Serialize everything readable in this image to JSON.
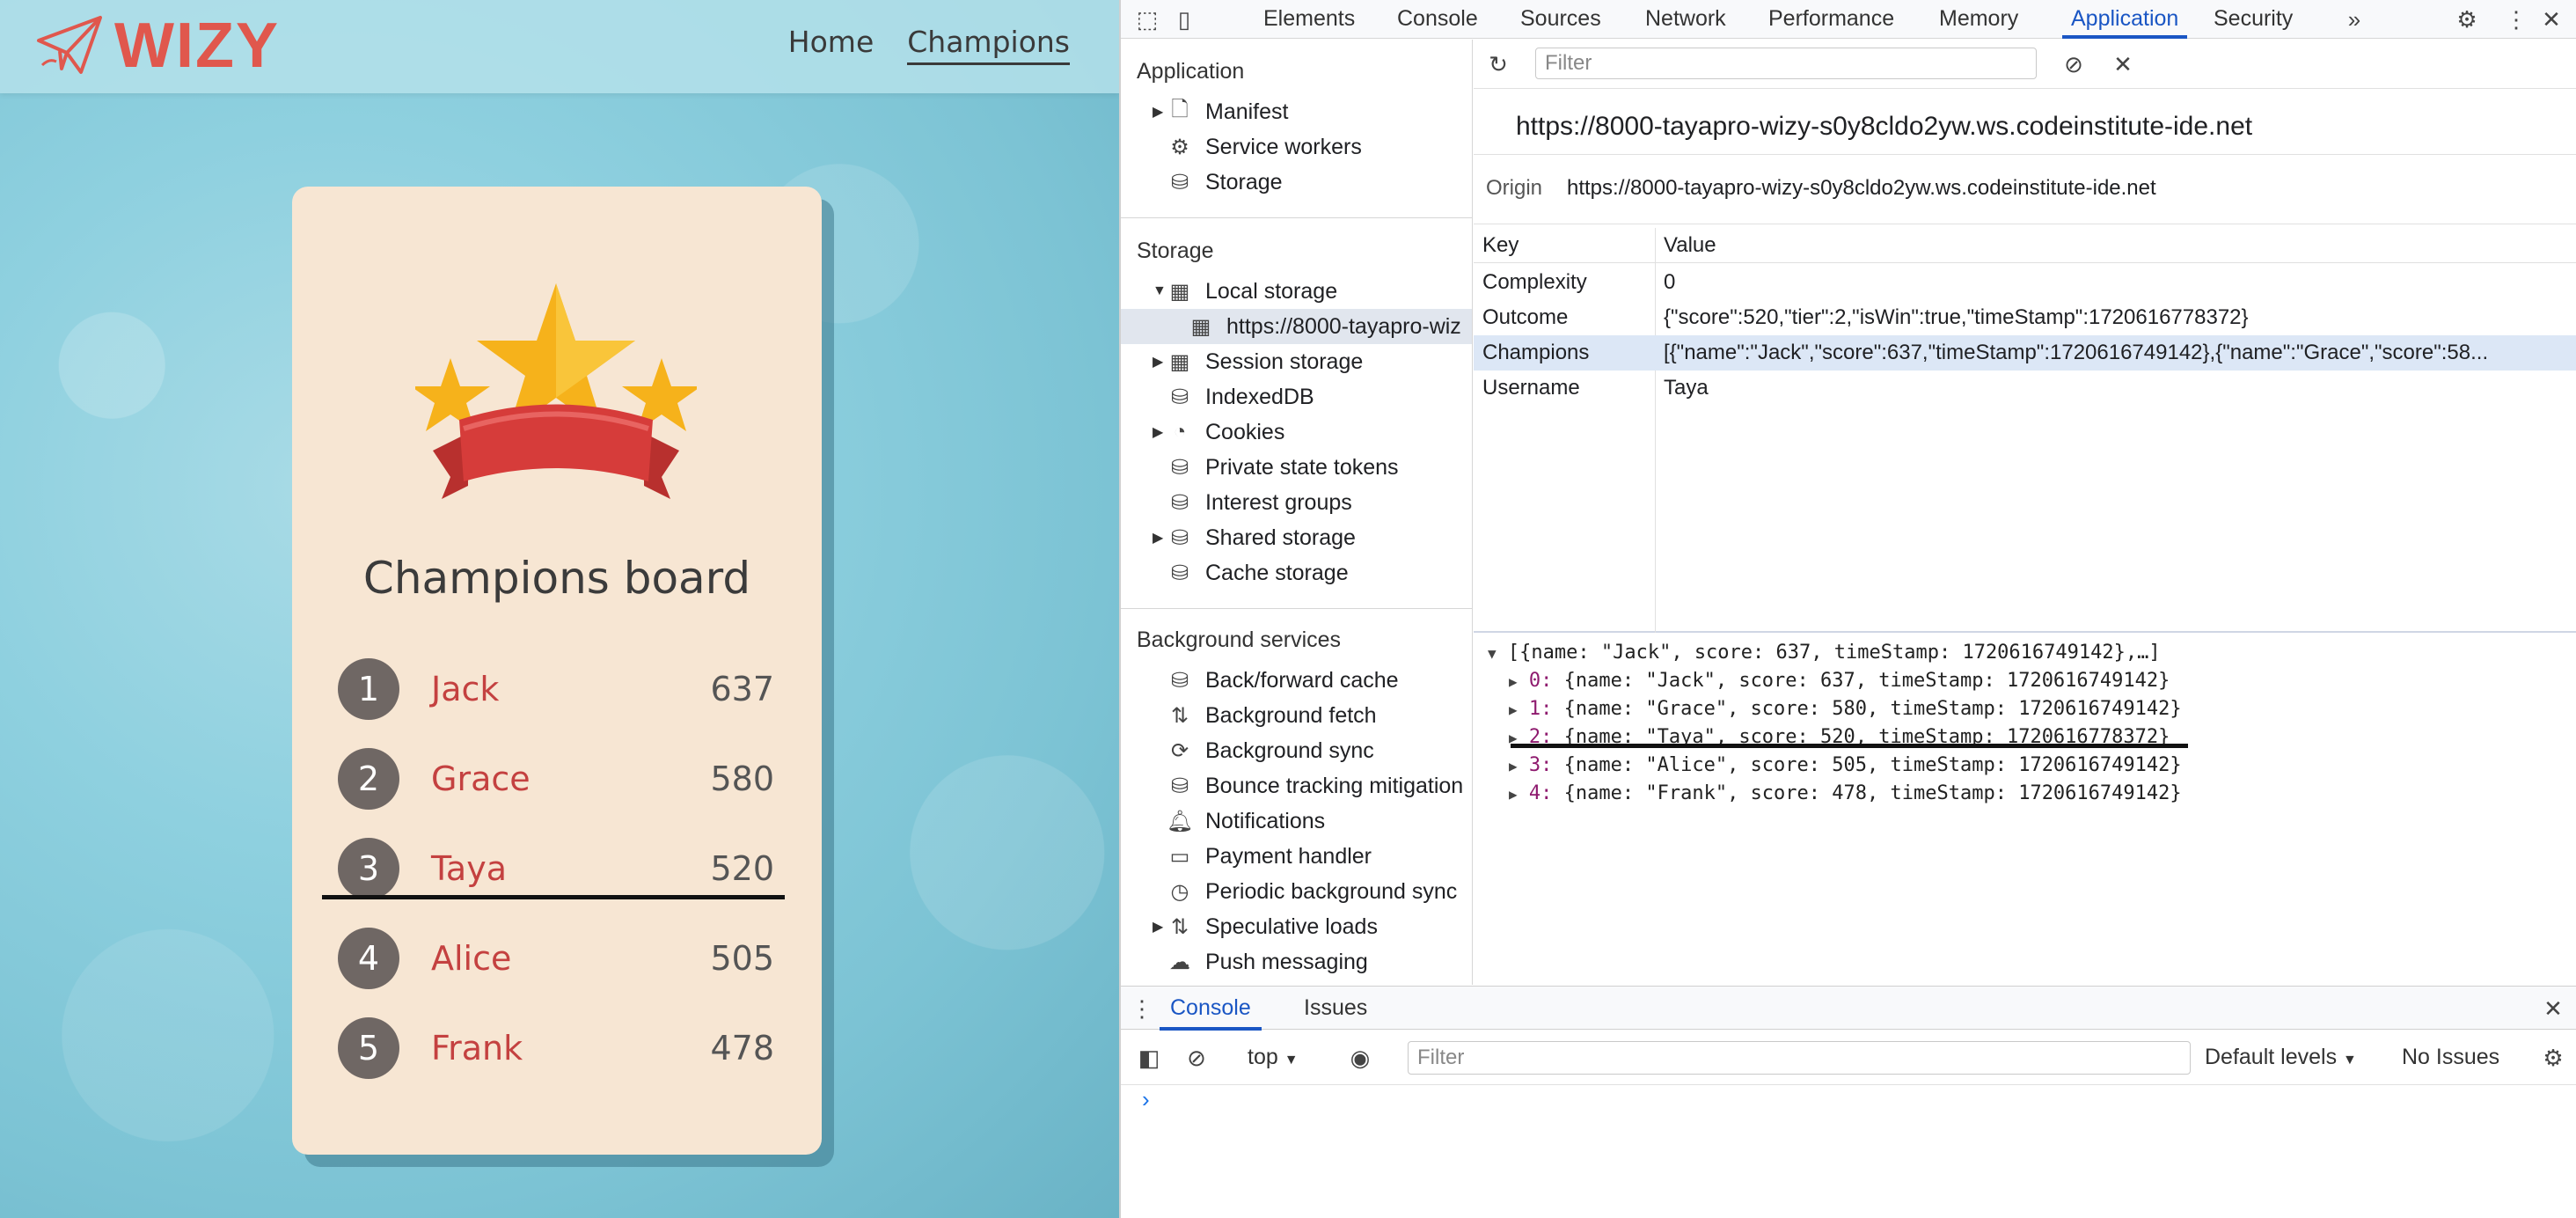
{
  "app": {
    "logo_text": "WIZY",
    "nav": [
      {
        "label": "Home"
      },
      {
        "label": "Champions"
      }
    ],
    "card_title": "Champions board",
    "rankings": [
      {
        "rank": "1",
        "name": "Jack",
        "score": "637"
      },
      {
        "rank": "2",
        "name": "Grace",
        "score": "580"
      },
      {
        "rank": "3",
        "name": "Taya",
        "score": "520"
      },
      {
        "rank": "4",
        "name": "Alice",
        "score": "505"
      },
      {
        "rank": "5",
        "name": "Frank",
        "score": "478"
      }
    ],
    "colors": {
      "brand": "#e0574d",
      "name_text": "#c44140",
      "card_bg": "#f7e6d3",
      "rank_badge": "#6f6764"
    }
  },
  "devtools": {
    "tabs": [
      "Elements",
      "Console",
      "Sources",
      "Network",
      "Performance",
      "Memory",
      "Application",
      "Security"
    ],
    "active_tab": "Application",
    "sidebar": {
      "application_header": "Application",
      "application_items": [
        "Manifest",
        "Service workers",
        "Storage"
      ],
      "storage_header": "Storage",
      "storage_items": [
        "Local storage",
        "https://8000-tayapro-wiz",
        "Session storage",
        "IndexedDB",
        "Cookies",
        "Private state tokens",
        "Interest groups",
        "Shared storage",
        "Cache storage"
      ],
      "background_header": "Background services",
      "background_items": [
        "Back/forward cache",
        "Background fetch",
        "Background sync",
        "Bounce tracking mitigation",
        "Notifications",
        "Payment handler",
        "Periodic background sync",
        "Speculative loads",
        "Push messaging"
      ]
    },
    "filter_placeholder": "Filter",
    "origin_url": "https://8000-tayapro-wizy-s0y8cldo2yw.ws.codeinstitute-ide.net",
    "origin_label": "Origin",
    "origin_value": "https://8000-tayapro-wizy-s0y8cldo2yw.ws.codeinstitute-ide.net",
    "table_headers": {
      "key": "Key",
      "value": "Value"
    },
    "storage_rows": [
      {
        "key": "Complexity",
        "value": "0"
      },
      {
        "key": "Outcome",
        "value": "{\"score\":520,\"tier\":2,\"isWin\":true,\"timeStamp\":1720616778372}"
      },
      {
        "key": "Champions",
        "value": "[{\"name\":\"Jack\",\"score\":637,\"timeStamp\":1720616749142},{\"name\":\"Grace\",\"score\":58..."
      },
      {
        "key": "Username",
        "value": "Taya"
      }
    ],
    "preview": {
      "summary": "[{name: \"Jack\", score: 637, timeStamp: 1720616749142},…]",
      "items": [
        {
          "index": "0:",
          "text": "{name: \"Jack\", score: 637, timeStamp: 1720616749142}"
        },
        {
          "index": "1:",
          "text": "{name: \"Grace\", score: 580, timeStamp: 1720616749142}"
        },
        {
          "index": "2:",
          "text": "{name: \"Taya\", score: 520, timeStamp: 1720616778372}"
        },
        {
          "index": "3:",
          "text": "{name: \"Alice\", score: 505, timeStamp: 1720616749142}"
        },
        {
          "index": "4:",
          "text": "{name: \"Frank\", score: 478, timeStamp: 1720616749142}"
        }
      ]
    },
    "drawer": {
      "tabs": [
        "Console",
        "Issues"
      ],
      "context": "top",
      "filter_placeholder": "Filter",
      "levels": "Default levels",
      "issues": "No Issues",
      "prompt": "›"
    },
    "colors": {
      "accent": "#1a56c4",
      "selected_row": "#dce7f6"
    }
  }
}
